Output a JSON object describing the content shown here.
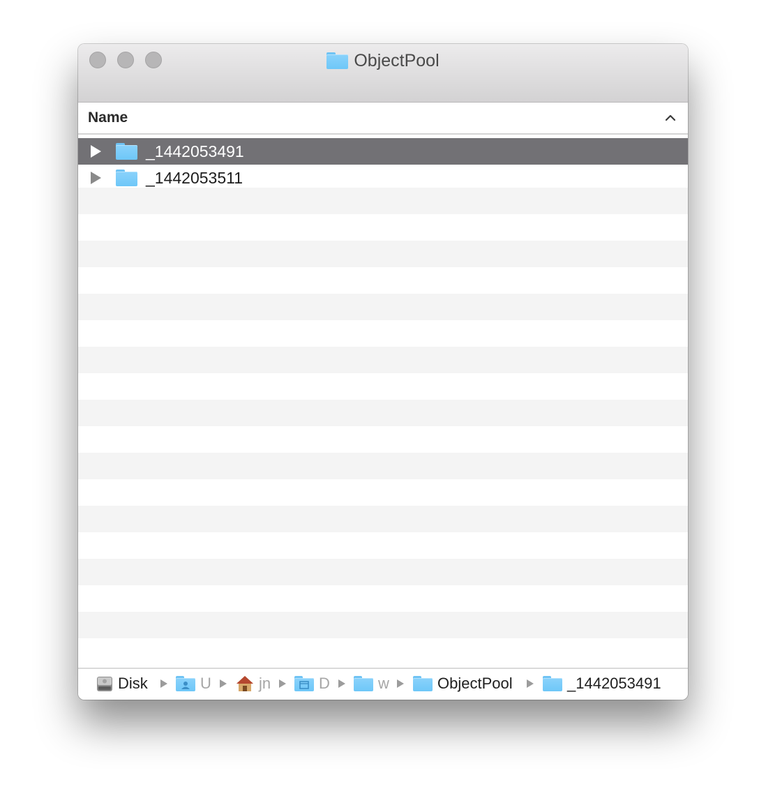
{
  "window": {
    "title": "ObjectPool",
    "title_icon": "folder-icon"
  },
  "header": {
    "column_name": "Name",
    "sort_icon": "chevron-up-icon"
  },
  "rows": [
    {
      "name": "_1442053491",
      "selected": true,
      "icon": "folder-icon"
    },
    {
      "name": "_1442053511",
      "selected": false,
      "icon": "folder-icon"
    }
  ],
  "pathbar": {
    "crumbs": [
      {
        "label": "Disk",
        "icon": "hard-disk-icon"
      },
      {
        "label": "U",
        "icon": "users-folder-icon"
      },
      {
        "label": "jn",
        "icon": "home-icon"
      },
      {
        "label": "D",
        "icon": "documents-folder-icon"
      },
      {
        "label": "w",
        "icon": "folder-icon"
      },
      {
        "label": "ObjectPool",
        "icon": "folder-icon"
      },
      {
        "label": "_1442053491",
        "icon": "folder-icon"
      }
    ]
  },
  "colors": {
    "selection": "#727175",
    "folder": "#7ccbf7",
    "stripe": "#f4f4f4"
  }
}
